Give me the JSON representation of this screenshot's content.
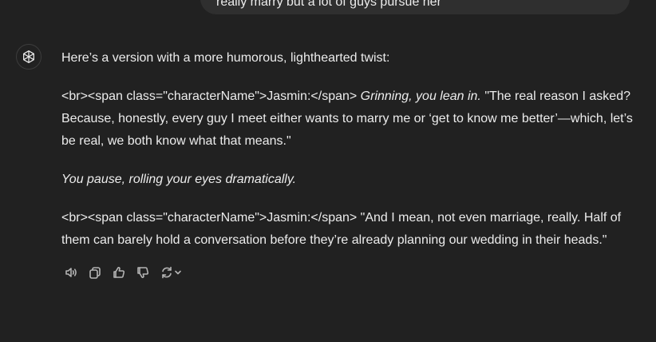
{
  "user_message": {
    "text": "really marry but a lot of guys pursue her"
  },
  "assistant": {
    "icon": "openai-logo-icon",
    "intro": "Here’s a version with a more humorous, lighthearted twist:",
    "para1": {
      "prefix": "<br><span class=\"characterName\">Jasmin:</span> ",
      "action": "Grinning, you lean in.",
      "dialogue": " \"The real reason I asked? Because, honestly, every guy I meet either wants to marry me or ‘get to know me better’—which, let’s be real, we both know what that means.\""
    },
    "para2": {
      "action": "You pause, rolling your eyes dramatically."
    },
    "para3": {
      "prefix": "<br><span class=\"characterName\">Jasmin:</span> ",
      "dialogue": "\"And I mean, not even marriage, really. Half of them can barely hold a conversation before they’re already planning our wedding in their heads.\""
    }
  },
  "actions": [
    {
      "name": "read-aloud",
      "icon": "speaker-icon"
    },
    {
      "name": "copy",
      "icon": "copy-icon"
    },
    {
      "name": "good-response",
      "icon": "thumbs-up-icon"
    },
    {
      "name": "bad-response",
      "icon": "thumbs-down-icon"
    },
    {
      "name": "regenerate",
      "icon": "refresh-icon"
    }
  ],
  "colors": {
    "background": "#212121",
    "bubble": "#2f2f2f",
    "text": "#ececec",
    "icon": "#b4b4b4"
  }
}
